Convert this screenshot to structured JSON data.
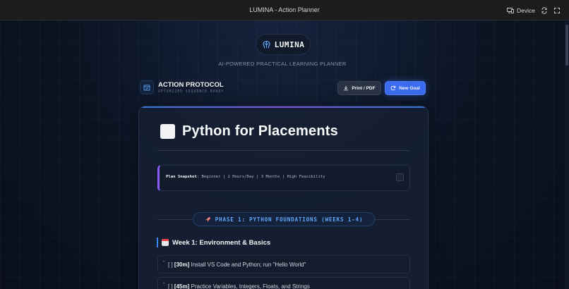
{
  "window": {
    "title": "LUMINA - Action Planner",
    "device_label": "Device"
  },
  "brand": {
    "name": "LUMINA",
    "tagline": "AI-POWERED PRACTICAL LEARNING PLANNER"
  },
  "protocol": {
    "title": "ACTION PROTOCOL",
    "subtitle": "OPTIMIZED SEQUENCE READY",
    "print_label": "Print / PDF",
    "new_goal_label": "New Goal"
  },
  "plan": {
    "title": "Python for Placements",
    "snapshot_label": "Plan Snapshot",
    "snapshot_text": ": Beginner | 2 Hours/Day | 3 Months | High Feasibility",
    "phase_label": "PHASE 1: PYTHON FOUNDATIONS (WEEKS 1-4)",
    "week_label": "Week 1: Environment & Basics",
    "tasks": [
      {
        "check": "[ ]",
        "duration": "[30m]",
        "text": "Install VS Code and Python; run \"Hello World\""
      },
      {
        "check": "[ ]",
        "duration": "[45m]",
        "text": "Practice Variables, Integers, Floats, and Strings"
      }
    ]
  },
  "colors": {
    "accent_blue": "#3b6cf0",
    "accent_purple": "#8b5cf6",
    "phase_text": "#60a5fa"
  },
  "icons": {
    "brand": "brain-icon",
    "protocol": "calendar-check-icon",
    "print": "download-icon",
    "new_goal": "refresh-icon",
    "phase": "rocket-icon",
    "week": "calendar-icon",
    "device": "device-icon",
    "sync": "sync-icon",
    "expand": "expand-icon"
  }
}
